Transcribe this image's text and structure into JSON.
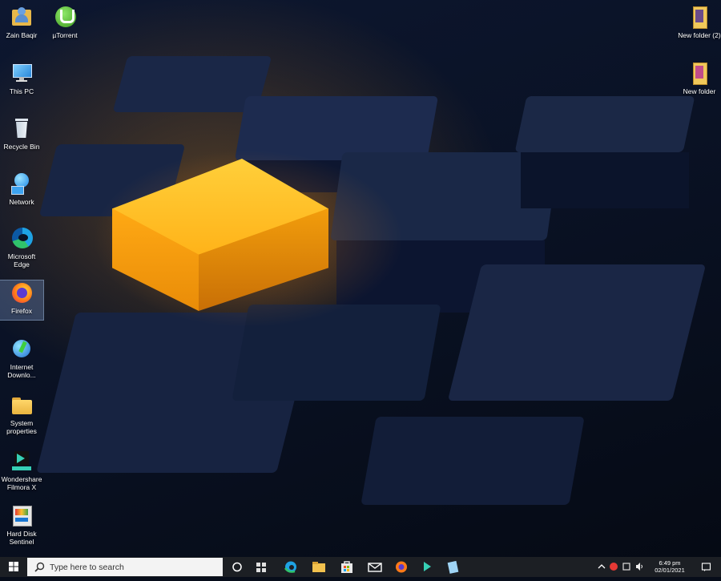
{
  "desktop_icons_left": [
    {
      "label": "Zain Baqir",
      "icon": "user-folder-icon"
    },
    {
      "label": "This PC",
      "icon": "computer-icon"
    },
    {
      "label": "Recycle Bin",
      "icon": "recycle-bin-icon"
    },
    {
      "label": "Network",
      "icon": "network-icon"
    },
    {
      "label": "Microsoft Edge",
      "icon": "edge-icon"
    },
    {
      "label": "Firefox",
      "icon": "firefox-icon"
    },
    {
      "label": "Internet Downlo...",
      "icon": "idm-icon"
    },
    {
      "label": "System properties",
      "icon": "folder-icon"
    },
    {
      "label": "Wondershare Filmora X",
      "icon": "filmora-icon"
    },
    {
      "label": "Hard Disk Sentinel",
      "icon": "hdd-sentinel-icon"
    }
  ],
  "desktop_icons_second": [
    {
      "label": "µTorrent",
      "icon": "utorrent-icon"
    }
  ],
  "desktop_icons_right": [
    {
      "label": "New folder (2)",
      "icon": "folder-icon"
    },
    {
      "label": "New folder",
      "icon": "folder-icon"
    }
  ],
  "taskbar": {
    "search_placeholder": "Type here to search",
    "clock_time": "6:49 pm",
    "clock_date": "02/01/2021"
  },
  "colors": {
    "wallpaper_dark": "#0a1225",
    "glow_cube": "#ffb21a",
    "taskbar": "#1c1f24"
  }
}
